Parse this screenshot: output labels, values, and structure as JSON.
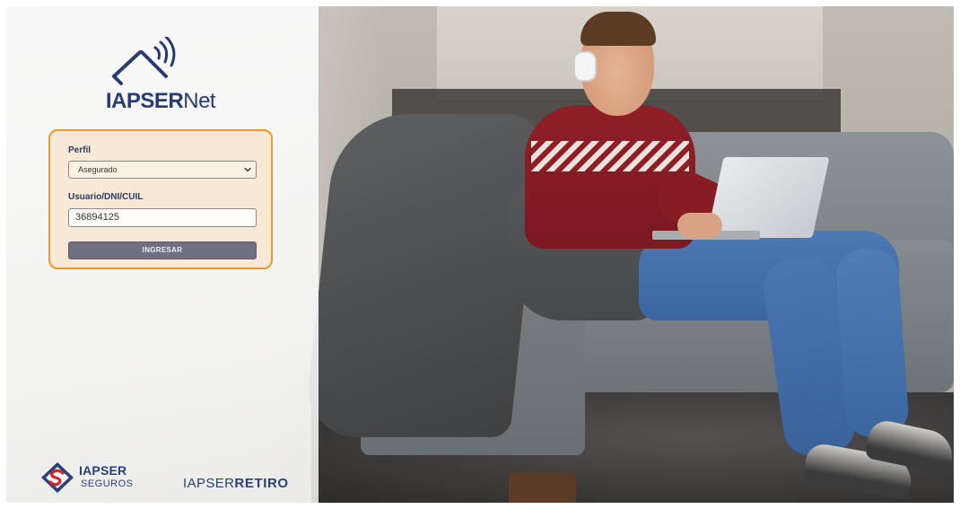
{
  "brand": {
    "name_strong": "IAPSER",
    "name_light": "Net",
    "primary_color": "#283c73",
    "accent_color": "#ee9a2a"
  },
  "login": {
    "profile_label": "Perfil",
    "profile_selected": "Asegurado",
    "user_label": "Usuario/DNI/CUIL",
    "user_value": "36894125",
    "submit_label": "INGRESAR"
  },
  "footer": {
    "seguros_name": "IAPSER",
    "seguros_sub": "SEGUROS",
    "retiro_prefix": "IAPSER",
    "retiro_suffix": "RETIRO"
  },
  "icons": {
    "logo": "house-wifi-icon",
    "select_arrow": "chevron-down-icon",
    "seguros_mark": "diamond-s-logo-icon"
  }
}
